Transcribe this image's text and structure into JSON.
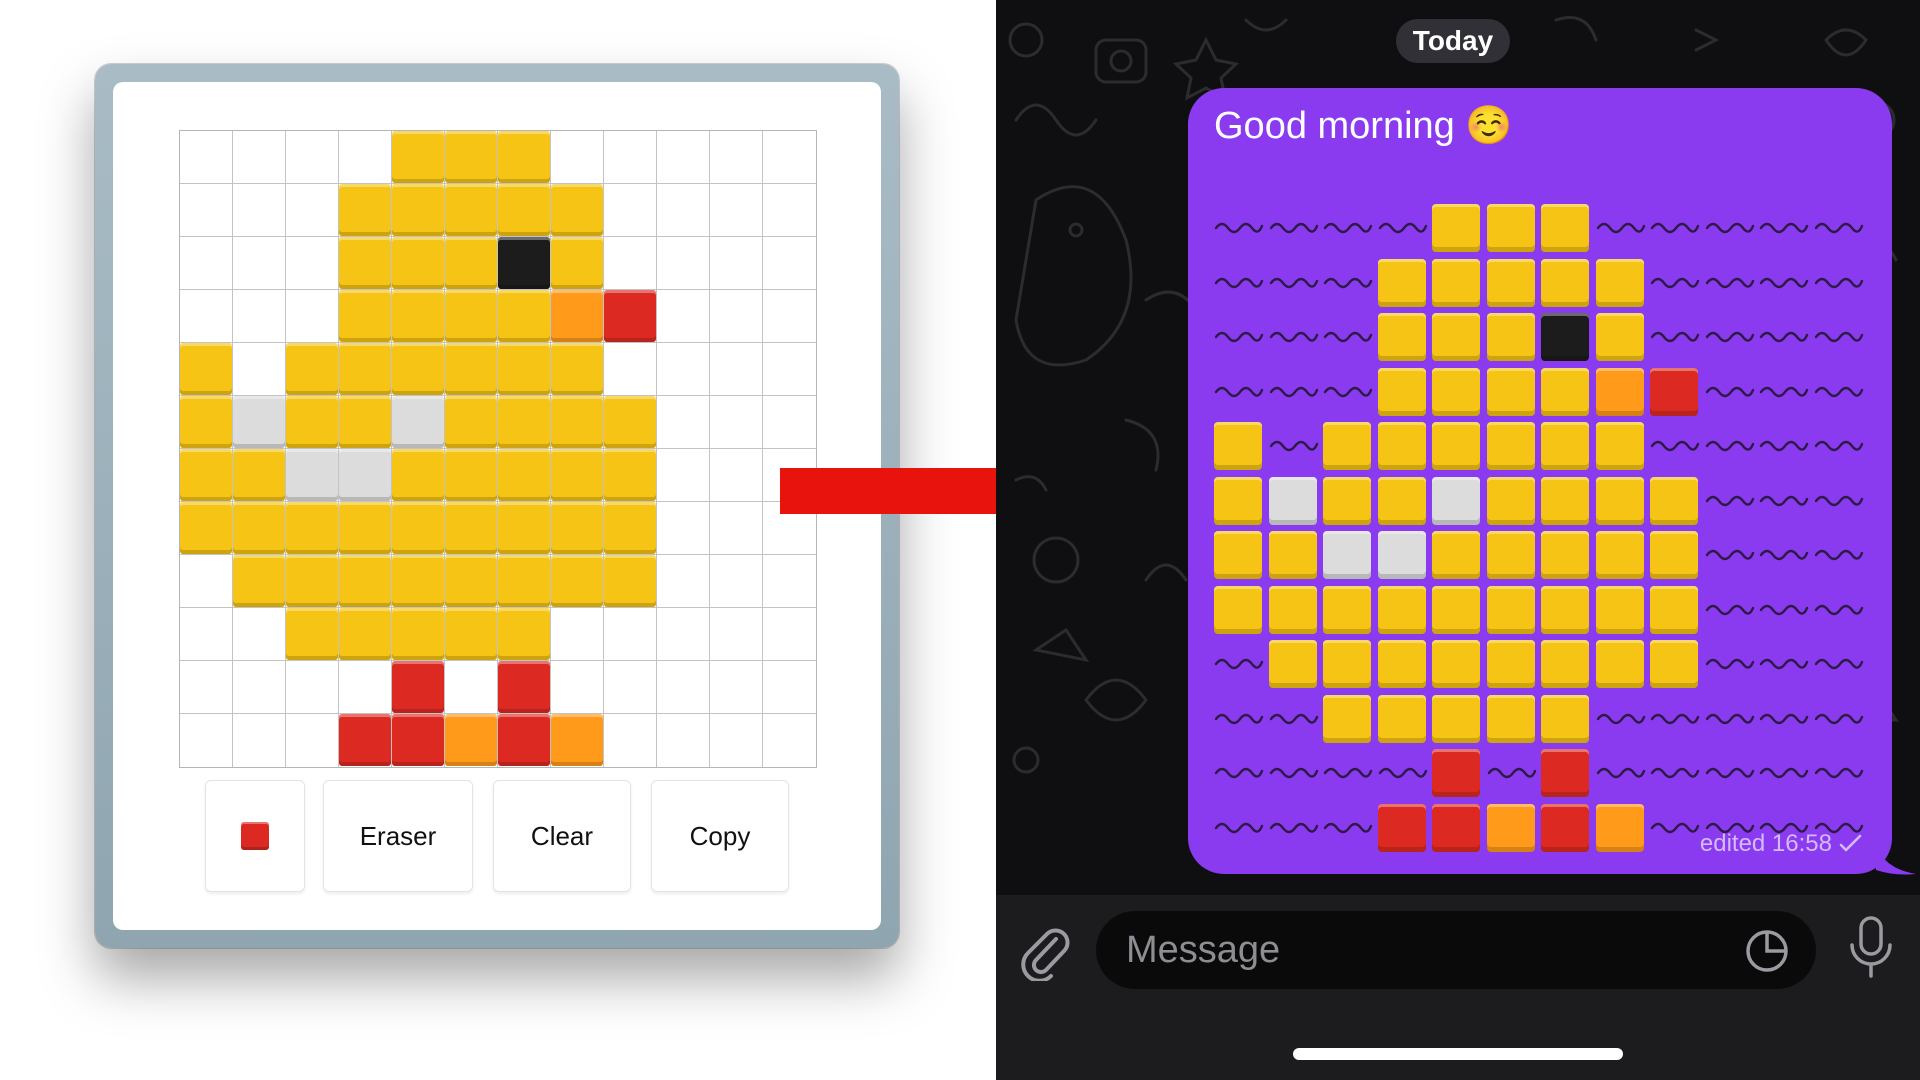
{
  "editor": {
    "rows": [
      "....YYY.....",
      "...YYYYY....",
      "...YYYKY....",
      "...YYYYOR...",
      "Y.YYYYYY....",
      "YGYYGYYYY...",
      "YYGGYYYYY...",
      "YYYYYYYYY...",
      ".YYYYYYYY...",
      "..YYYYY.....",
      "....R.R.....",
      "...RROR0....."
    ],
    "toolbar": {
      "color_name": "red",
      "eraser_label": "Eraser",
      "clear_label": "Clear",
      "copy_label": "Copy"
    }
  },
  "colors": {
    "Y": "#f5c414",
    "O": "#ff9a1a",
    "R": "#dc2a22",
    "K": "#1c1c1c",
    "G": "#dcdcdc",
    "bubble": "#8a3bf0",
    "chat_bg": "#0f0f11",
    "arrow": "#e8130d"
  },
  "chat": {
    "date_label": "Today",
    "message_text": "Good morning ☺️",
    "edited_label": "edited 16:58",
    "input_placeholder": "Message",
    "icons": [
      "paperclip-icon",
      "sticker-icon",
      "microphone-icon",
      "double-check-icon"
    ]
  }
}
